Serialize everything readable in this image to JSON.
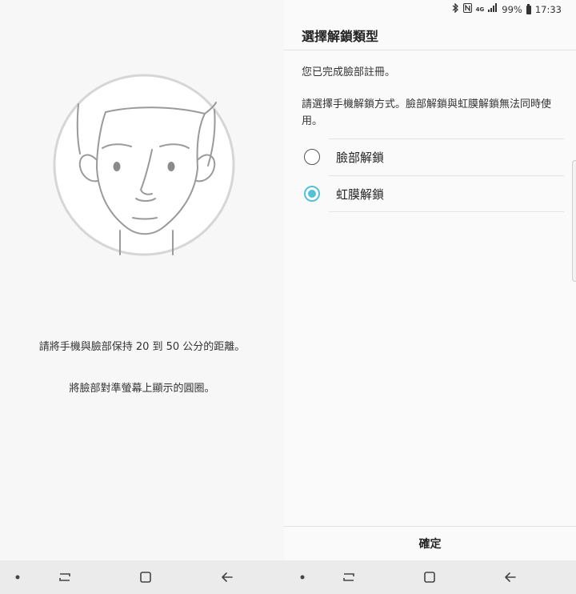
{
  "status_bar": {
    "bluetooth_icon": "bluetooth-icon",
    "nfc_icon": "nfc-icon",
    "network_label": "4G",
    "battery_percent": "99%",
    "time": "17:33"
  },
  "left": {
    "illustration": "face-illustration",
    "instruction_1": "請將手機與臉部保持 20 到 50 公分的距離。",
    "instruction_2": "將臉部對準螢幕上顯示的圓圈。"
  },
  "right": {
    "title": "選擇解鎖類型",
    "description_1": "您已完成臉部註冊。",
    "description_2": "請選擇手機解鎖方式。臉部解鎖與虹膜解鎖無法同時使用。",
    "options": [
      {
        "label": "臉部解鎖",
        "selected": false
      },
      {
        "label": "虹膜解鎖",
        "selected": true
      }
    ],
    "confirm_label": "確定"
  },
  "colors": {
    "accent": "#54c1d8",
    "background": "#f7f7f7",
    "navbar": "#ebebeb"
  },
  "navbar": {
    "items": [
      "dot-icon",
      "recent-apps-icon",
      "home-icon",
      "back-icon"
    ]
  }
}
